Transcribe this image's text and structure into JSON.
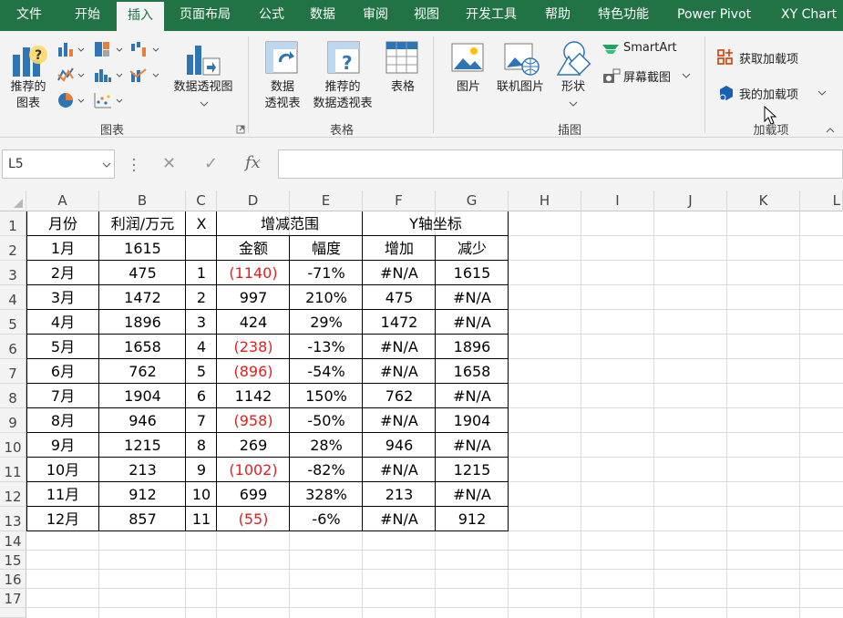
{
  "tabs": [
    {
      "label": "文件",
      "active": false
    },
    {
      "label": "开始",
      "active": false
    },
    {
      "label": "插入",
      "active": true
    },
    {
      "label": "页面布局",
      "active": false
    },
    {
      "label": "公式",
      "active": false
    },
    {
      "label": "数据",
      "active": false
    },
    {
      "label": "审阅",
      "active": false
    },
    {
      "label": "视图",
      "active": false
    },
    {
      "label": "开发工具",
      "active": false
    },
    {
      "label": "帮助",
      "active": false
    },
    {
      "label": "特色功能",
      "active": false
    },
    {
      "label": "Power Pivot",
      "active": false
    },
    {
      "label": "XY Chart",
      "active": false
    }
  ],
  "ribbon": {
    "recommended_charts": [
      "推荐的",
      "图表"
    ],
    "pivot_chart": "数据透视图",
    "group_charts": "图表",
    "pivot_table": [
      "数据",
      "透视表"
    ],
    "recommended_pivot": [
      "推荐的",
      "数据透视表"
    ],
    "table": "表格",
    "group_tables": "表格",
    "pictures": "图片",
    "online_pictures": "联机图片",
    "shapes": "形状",
    "smartart": "SmartArt",
    "screenshot": "屏幕截图",
    "group_illustrations": "插图",
    "get_addins": "获取加载项",
    "my_addins": "我的加载项",
    "group_addins": "加载项",
    "colors": {
      "accent": "#217346",
      "addin_red": "#d83b01",
      "addin_blue": "#1a5fb4"
    }
  },
  "formula_bar": {
    "name_box": "L5",
    "cancel": "✕",
    "enter": "✓",
    "fx": "fx",
    "value": ""
  },
  "columns": [
    "A",
    "B",
    "C",
    "D",
    "E",
    "F",
    "G",
    "H",
    "I",
    "J",
    "K",
    "L"
  ],
  "rows": [
    "1",
    "2",
    "3",
    "4",
    "5",
    "6",
    "7",
    "8",
    "9",
    "10",
    "11",
    "12",
    "13",
    "14",
    "15",
    "16",
    "17"
  ],
  "headers": {
    "row1": {
      "month": "月份",
      "profit": "利润/万元",
      "x": "X",
      "range": "增减范围",
      "yaxis": "Y轴坐标"
    },
    "row2": {
      "month": "1月",
      "profit": "1615",
      "amount": "金额",
      "pct": "幅度",
      "inc": "增加",
      "dec": "减少"
    }
  },
  "table": [
    {
      "month": "2月",
      "profit": "475",
      "x": "1",
      "amount": "(1140)",
      "pct": "-71%",
      "inc": "#N/A",
      "dec": "1615",
      "neg": true
    },
    {
      "month": "3月",
      "profit": "1472",
      "x": "2",
      "amount": "997",
      "pct": "210%",
      "inc": "475",
      "dec": "#N/A",
      "neg": false
    },
    {
      "month": "4月",
      "profit": "1896",
      "x": "3",
      "amount": "424",
      "pct": "29%",
      "inc": "1472",
      "dec": "#N/A",
      "neg": false
    },
    {
      "month": "5月",
      "profit": "1658",
      "x": "4",
      "amount": "(238)",
      "pct": "-13%",
      "inc": "#N/A",
      "dec": "1896",
      "neg": true
    },
    {
      "month": "6月",
      "profit": "762",
      "x": "5",
      "amount": "(896)",
      "pct": "-54%",
      "inc": "#N/A",
      "dec": "1658",
      "neg": true
    },
    {
      "month": "7月",
      "profit": "1904",
      "x": "6",
      "amount": "1142",
      "pct": "150%",
      "inc": "762",
      "dec": "#N/A",
      "neg": false
    },
    {
      "month": "8月",
      "profit": "946",
      "x": "7",
      "amount": "(958)",
      "pct": "-50%",
      "inc": "#N/A",
      "dec": "1904",
      "neg": true
    },
    {
      "month": "9月",
      "profit": "1215",
      "x": "8",
      "amount": "269",
      "pct": "28%",
      "inc": "946",
      "dec": "#N/A",
      "neg": false
    },
    {
      "month": "10月",
      "profit": "213",
      "x": "9",
      "amount": "(1002)",
      "pct": "-82%",
      "inc": "#N/A",
      "dec": "1215",
      "neg": true
    },
    {
      "month": "11月",
      "profit": "912",
      "x": "10",
      "amount": "699",
      "pct": "328%",
      "inc": "213",
      "dec": "#N/A",
      "neg": false
    },
    {
      "month": "12月",
      "profit": "857",
      "x": "11",
      "amount": "(55)",
      "pct": "-6%",
      "inc": "#N/A",
      "dec": "912",
      "neg": true
    }
  ]
}
